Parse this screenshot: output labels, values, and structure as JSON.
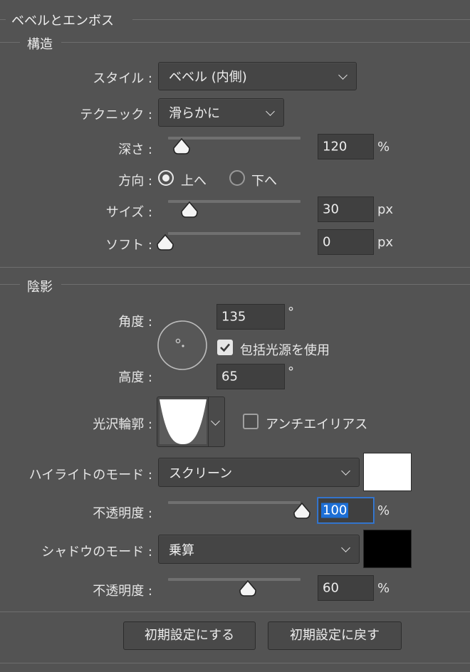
{
  "panel_title": "ベベルとエンボス",
  "structure": {
    "title": "構造",
    "style": {
      "label": "スタイル :",
      "value": "ベベル (内側)"
    },
    "technique": {
      "label": "テクニック :",
      "value": "滑らかに"
    },
    "depth": {
      "label": "深さ :",
      "value": "120",
      "unit": "%",
      "slider_fraction": 0.1
    },
    "direction": {
      "label": "方向 :",
      "options": [
        "上へ",
        "下へ"
      ],
      "selected": "上へ"
    },
    "size": {
      "label": "サイズ :",
      "value": "30",
      "unit": "px",
      "slider_fraction": 0.16
    },
    "soften": {
      "label": "ソフト :",
      "value": "0",
      "unit": "px",
      "slider_fraction": 0.0
    }
  },
  "shading": {
    "title": "陰影",
    "angle": {
      "label": "角度 :",
      "value": "135",
      "unit": "°"
    },
    "global_light": {
      "label": "包括光源を使用",
      "checked": true
    },
    "altitude": {
      "label": "高度 :",
      "value": "65",
      "unit": "°"
    },
    "gloss_contour": {
      "label": "光沢輪郭 :"
    },
    "anti_aliased": {
      "label": "アンチエイリアス",
      "checked": false
    },
    "highlight_mode": {
      "label": "ハイライトのモード :",
      "value": "スクリーン",
      "color": "#ffffff"
    },
    "highlight_opacity": {
      "label": "不透明度 :",
      "value": "100",
      "unit": "%",
      "slider_fraction": 1.0
    },
    "shadow_mode": {
      "label": "シャドウのモード :",
      "value": "乗算",
      "color": "#000000"
    },
    "shadow_opacity": {
      "label": "不透明度 :",
      "value": "60",
      "unit": "%",
      "slider_fraction": 0.6
    }
  },
  "buttons": {
    "make_default": "初期設定にする",
    "reset_default": "初期設定に戻す"
  },
  "colors": {
    "panel_bg": "#535353",
    "selection": "#1d6fd6"
  }
}
